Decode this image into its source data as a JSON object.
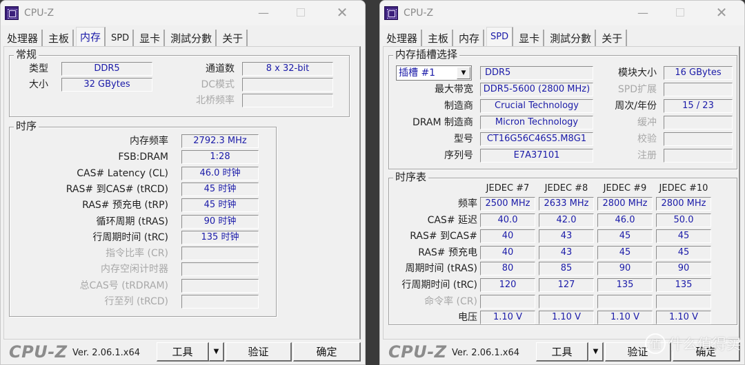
{
  "windows": [
    {
      "title": "CPU-Z",
      "tabs": [
        "处理器",
        "主板",
        "内存",
        "SPD",
        "显卡",
        "測試分數",
        "关于"
      ],
      "active_tab": "内存",
      "general": {
        "group_title": "常规",
        "type_label": "类型",
        "type_value": "DDR5",
        "size_label": "大小",
        "size_value": "32 GBytes",
        "channels_label": "通道数",
        "channels_value": "8 x 32-bit",
        "dc_mode_label": "DC模式",
        "dc_mode_value": "",
        "nb_freq_label": "北桥频率",
        "nb_freq_value": ""
      },
      "timings": {
        "group_title": "时序",
        "rows": [
          {
            "label": "内存频率",
            "value": "2792.3 MHz",
            "enabled": true
          },
          {
            "label": "FSB:DRAM",
            "value": "1:28",
            "enabled": true
          },
          {
            "label": "CAS# Latency (CL)",
            "value": "46.0 时钟",
            "enabled": true
          },
          {
            "label": "RAS# 到CAS# (tRCD)",
            "value": "45 时钟",
            "enabled": true
          },
          {
            "label": "RAS# 预充电 (tRP)",
            "value": "45 时钟",
            "enabled": true
          },
          {
            "label": "循环周期 (tRAS)",
            "value": "90 时钟",
            "enabled": true
          },
          {
            "label": "行周期时间 (tRC)",
            "value": "135 时钟",
            "enabled": true
          },
          {
            "label": "指令比率 (CR)",
            "value": "",
            "enabled": false
          },
          {
            "label": "内存空闲计时器",
            "value": "",
            "enabled": false
          },
          {
            "label": "总CAS号 (tRDRAM)",
            "value": "",
            "enabled": false
          },
          {
            "label": "行至列 (tRCD)",
            "value": "",
            "enabled": false
          }
        ]
      },
      "footer": {
        "brand": "CPU-Z",
        "version": "Ver. 2.06.1.x64",
        "tools": "工具",
        "validate": "验证",
        "ok": "确定"
      }
    },
    {
      "title": "CPU-Z",
      "tabs": [
        "处理器",
        "主板",
        "内存",
        "SPD",
        "显卡",
        "測試分數",
        "关于"
      ],
      "active_tab": "SPD",
      "slot": {
        "group_title": "内存插槽选择",
        "slot_selected": "插槽 #1",
        "type_value": "DDR5",
        "max_bw_label": "最大带宽",
        "max_bw_value": "DDR5-5600 (2800 MHz)",
        "manufacturer_label": "制造商",
        "manufacturer_value": "Crucial Technology",
        "dram_mfr_label": "DRAM 制造商",
        "dram_mfr_value": "Micron Technology",
        "part_label": "型号",
        "part_value": "CT16G56C46S5.M8G1",
        "serial_label": "序列号",
        "serial_value": "E7A37101",
        "module_size_label": "模块大小",
        "module_size_value": "16 GBytes",
        "spd_ext_label": "SPD扩展",
        "spd_ext_value": "",
        "week_year_label": "周次/年份",
        "week_year_value": "15 / 23",
        "buffered_label": "缓冲",
        "buffered_value": "",
        "correction_label": "校验",
        "correction_value": "",
        "registered_label": "注册",
        "registered_value": ""
      },
      "timing_table": {
        "group_title": "时序表",
        "columns": [
          "JEDEC #7",
          "JEDEC #8",
          "JEDEC #9",
          "JEDEC #10"
        ],
        "rows": [
          {
            "label": "频率",
            "enabled": true,
            "values": [
              "2500 MHz",
              "2633 MHz",
              "2800 MHz",
              "2800 MHz"
            ]
          },
          {
            "label": "CAS# 延迟",
            "enabled": true,
            "values": [
              "40.0",
              "42.0",
              "46.0",
              "50.0"
            ]
          },
          {
            "label": "RAS# 到CAS#",
            "enabled": true,
            "values": [
              "40",
              "43",
              "45",
              "45"
            ]
          },
          {
            "label": "RAS# 预充电",
            "enabled": true,
            "values": [
              "40",
              "43",
              "45",
              "45"
            ]
          },
          {
            "label": "周期时间 (tRAS)",
            "enabled": true,
            "values": [
              "80",
              "85",
              "90",
              "90"
            ]
          },
          {
            "label": "行周期时间 (tRC)",
            "enabled": true,
            "values": [
              "120",
              "127",
              "135",
              "135"
            ]
          },
          {
            "label": "命令率 (CR)",
            "enabled": false,
            "values": [
              "",
              "",
              "",
              ""
            ]
          },
          {
            "label": "电压",
            "enabled": true,
            "values": [
              "1.10 V",
              "1.10 V",
              "1.10 V",
              "1.10 V"
            ]
          }
        ]
      },
      "footer": {
        "brand": "CPU-Z",
        "version": "Ver. 2.06.1.x64",
        "tools": "工具",
        "validate": "验证",
        "ok": "确定"
      }
    }
  ],
  "watermark": {
    "icon_glyph": "值",
    "text": "什么值得买"
  },
  "colors": {
    "value_text": "#1a1aa8",
    "disabled_text": "#a8a8a8",
    "app_icon": "#3b1f7a",
    "desktop": "#3a3a3a"
  }
}
